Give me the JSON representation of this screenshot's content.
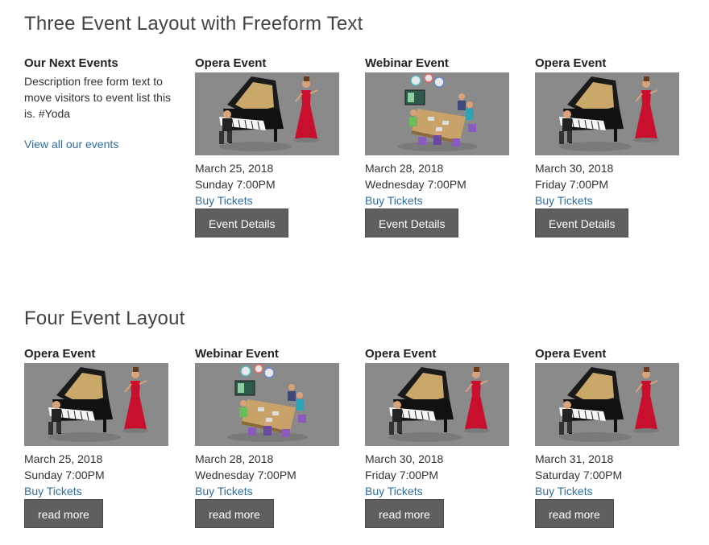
{
  "section1": {
    "title": "Three Event Layout with Freeform Text",
    "intro": {
      "title": "Our Next Events",
      "description": "Description free form text to move visitors to event list this is. #Yoda",
      "link": "View all our events"
    },
    "events": [
      {
        "title": "Opera Event",
        "image": "opera-piano-illustration",
        "date": "March 25, 2018",
        "time": "Sunday 7:00PM",
        "buy": "Buy Tickets",
        "button": "Event Details"
      },
      {
        "title": "Webinar Event",
        "image": "webinar-meeting-illustration",
        "date": "March 28, 2018",
        "time": "Wednesday 7:00PM",
        "buy": "Buy Tickets",
        "button": "Event Details"
      },
      {
        "title": "Opera Event",
        "image": "opera-piano-illustration",
        "date": "March 30, 2018",
        "time": "Friday 7:00PM",
        "buy": "Buy Tickets",
        "button": "Event Details"
      }
    ]
  },
  "section2": {
    "title": "Four Event Layout",
    "events": [
      {
        "title": "Opera Event",
        "image": "opera-piano-illustration",
        "date": "March 25, 2018",
        "time": "Sunday 7:00PM",
        "buy": "Buy Tickets",
        "button": "read more"
      },
      {
        "title": "Webinar Event",
        "image": "webinar-meeting-illustration",
        "date": "March 28, 2018",
        "time": "Wednesday 7:00PM",
        "buy": "Buy Tickets",
        "button": "read more"
      },
      {
        "title": "Opera Event",
        "image": "opera-piano-illustration",
        "date": "March 30, 2018",
        "time": "Friday 7:00PM",
        "buy": "Buy Tickets",
        "button": "read more"
      },
      {
        "title": "Opera Event",
        "image": "opera-piano-illustration",
        "date": "March 31, 2018",
        "time": "Saturday 7:00PM",
        "buy": "Buy Tickets",
        "button": "read more"
      }
    ]
  },
  "colors": {
    "link": "#2e6da4",
    "button": "#5f5f5f",
    "thumb_bg": "#8a8a8a"
  }
}
